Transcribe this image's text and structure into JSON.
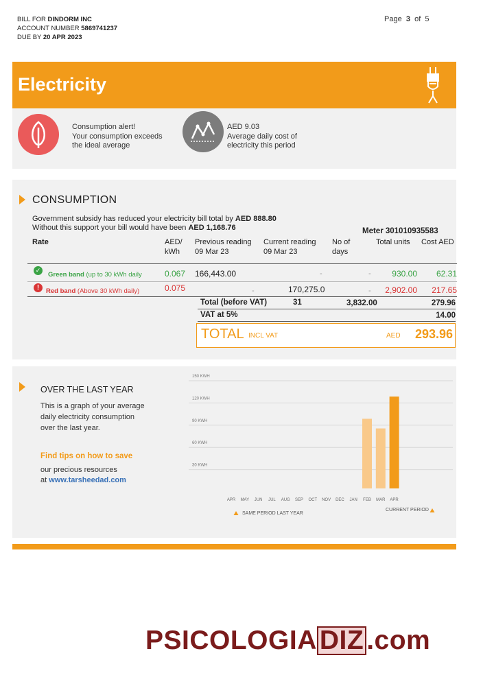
{
  "header": {
    "bill_for_label": "BILL FOR",
    "bill_for_value": "DINDORM INC",
    "account_label": "ACCOUNT NUMBER",
    "account_value": "5869741237",
    "due_label": "DUE BY",
    "due_value": "20 APR 2023",
    "page_label": "Page",
    "page_current": "3",
    "page_of": "of",
    "page_total": "5"
  },
  "banner": {
    "title": "Electricity",
    "icon": "plug-icon",
    "color": "#f29b1a"
  },
  "alerts": {
    "alert1_line1": "Consumption alert!",
    "alert1_line2": "Your consumption exceeds",
    "alert1_line3": "the ideal average",
    "alert2_line1": "AED 9.03",
    "alert2_line2": "Average daily cost of",
    "alert2_line3": "electricity this period"
  },
  "consumption": {
    "title": "CONSUMPTION",
    "subsidy_text": "Government subsidy has reduced your electricity bill total by",
    "subsidy_value": "AED 888.80",
    "without_text": "Without this support your bill would have been",
    "without_value": "AED 1,168.76",
    "meter": "Meter 301010935583",
    "columns": {
      "rate": "Rate",
      "aed_line1": "AED/",
      "aed_line2": "kWh",
      "prev_line1": "Previous reading",
      "prev_line2": "09 Mar 23",
      "curr_line1": "Current reading",
      "curr_line2": "09 Mar 23",
      "days_line1": "No of",
      "days_line2": "days",
      "units": "Total units",
      "cost": "Cost AED"
    },
    "rows": [
      {
        "band": "Green band",
        "note": "(up to 30 kWh daily",
        "rate": "0.067",
        "prev": "166,443.00",
        "curr": "-",
        "days": "-",
        "units": "930.00",
        "cost": "62.31"
      },
      {
        "band": "Red band",
        "note": "(Above 30 kWh daily)",
        "rate": "0.075",
        "prev": "-",
        "curr": "170,275.0",
        "days": "-",
        "units": "2,902.00",
        "cost": "217.65"
      }
    ],
    "total_before_vat_label": "Total (before VAT)",
    "total_days": "31",
    "total_units": "3,832.00",
    "total_cost": "279.96",
    "vat_label": "VAT at 5%",
    "vat_value": "14.00",
    "total_label": "TOTAL",
    "incl_vat": "INCL VAT",
    "aed": "AED",
    "total_value": "293.96"
  },
  "year": {
    "title": "OVER THE LAST YEAR",
    "desc_line1": "This is a graph of your average",
    "desc_line2": "daily electricity consumption",
    "desc_line3": "over the last year.",
    "tips_title": "Find tips on how to save",
    "tips_line2": "our precious resources",
    "tips_at": "at",
    "tips_link": "www.tarsheedad.com",
    "legend_same": "SAME PERIOD LAST YEAR",
    "legend_current": "CURRENT PERIOD"
  },
  "chart_data": {
    "type": "bar",
    "categories": [
      "APR",
      "MAY",
      "JUN",
      "JUL",
      "AUG",
      "SEP",
      "OCT",
      "NOV",
      "DEC",
      "JAN",
      "FEB",
      "MAR",
      "APR"
    ],
    "series": [
      {
        "name": "SAME PERIOD LAST YEAR",
        "values": [
          null,
          null,
          null,
          null,
          null,
          null,
          null,
          null,
          null,
          null,
          94,
          81,
          null
        ],
        "color": "#f9c98a"
      },
      {
        "name": "CURRENT PERIOD",
        "values": [
          null,
          null,
          null,
          null,
          null,
          null,
          null,
          null,
          null,
          null,
          null,
          null,
          124
        ],
        "color": "#f29b1a"
      }
    ],
    "yticks": [
      "30 KWH",
      "60 KWH",
      "90 KWH",
      "120 KWH",
      "150 KWH"
    ],
    "ytick_values": [
      30,
      60,
      90,
      120,
      150
    ],
    "ylim": [
      0,
      150
    ],
    "grid": true,
    "title": "",
    "xlabel": "",
    "ylabel": ""
  },
  "watermark": {
    "part1": "PSICOLOGIA",
    "part2": "DIZ",
    "part3": ".com"
  }
}
